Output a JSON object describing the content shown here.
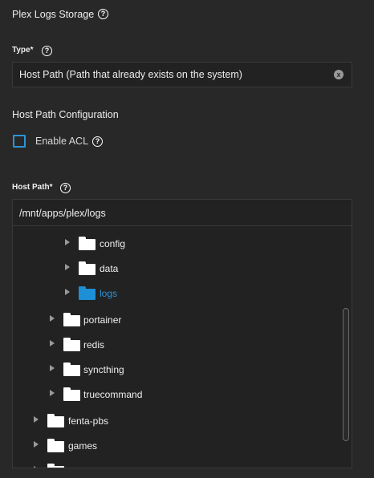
{
  "header": {
    "title": "Plex Logs Storage"
  },
  "type_field": {
    "label": "Type",
    "required_mark": "*",
    "value": "Host Path (Path that already exists on the system)",
    "clear_icon": "x"
  },
  "host_path_config": {
    "title": "Host Path Configuration",
    "enable_acl_label": "Enable ACL",
    "enable_acl_checked": false
  },
  "host_path_field": {
    "label": "Host Path",
    "required_mark": "*",
    "value": "/mnt/apps/plex/logs"
  },
  "help_icon_glyph": "?",
  "tree": {
    "items": [
      {
        "label": "config",
        "selected": false
      },
      {
        "label": "data",
        "selected": false
      },
      {
        "label": "logs",
        "selected": true
      },
      {
        "label": "portainer",
        "selected": false
      },
      {
        "label": "redis",
        "selected": false
      },
      {
        "label": "syncthing",
        "selected": false
      },
      {
        "label": "truecommand",
        "selected": false
      },
      {
        "label": "fenta-pbs",
        "selected": false
      },
      {
        "label": "games",
        "selected": false
      }
    ]
  },
  "colors": {
    "background": "#282828",
    "accent": "#2b93d8",
    "text": "#eeeeee"
  }
}
